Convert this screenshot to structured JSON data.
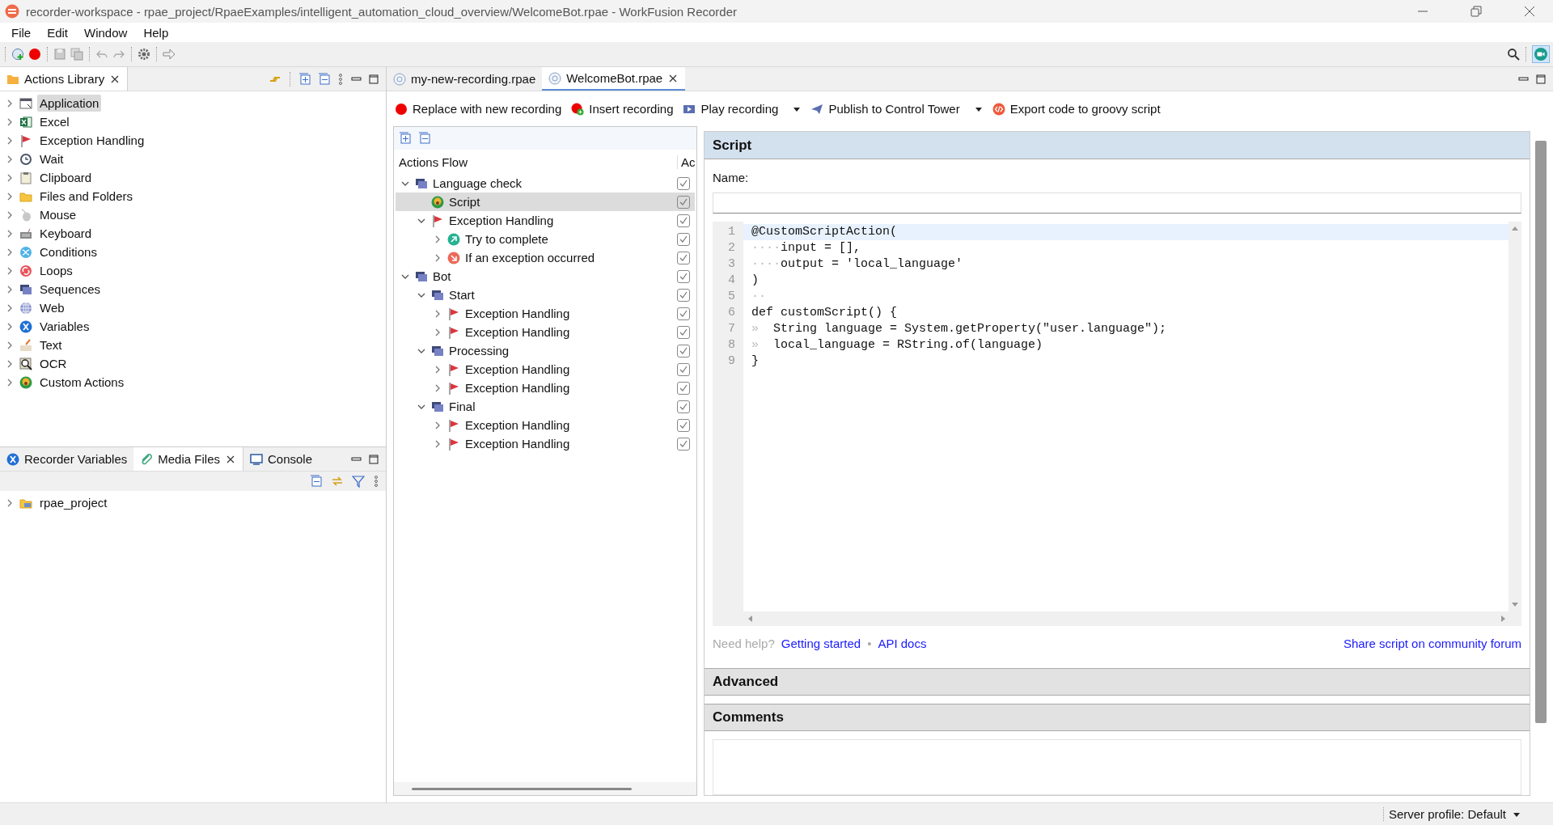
{
  "window": {
    "title": "recorder-workspace - rpae_project/RpaeExamples/intelligent_automation_cloud_overview/WelcomeBot.rpae - WorkFusion Recorder"
  },
  "menu": [
    "File",
    "Edit",
    "Window",
    "Help"
  ],
  "actions_library": {
    "title": "Actions Library",
    "items": [
      {
        "label": "Application",
        "kind": "application",
        "expanded": false,
        "selected": true
      },
      {
        "label": "Excel",
        "kind": "excel",
        "expanded": false,
        "selected": false
      },
      {
        "label": "Exception Handling",
        "kind": "flag",
        "expanded": false,
        "selected": false
      },
      {
        "label": "Wait",
        "kind": "clock",
        "expanded": false,
        "selected": false
      },
      {
        "label": "Clipboard",
        "kind": "clipboard",
        "expanded": false,
        "selected": false
      },
      {
        "label": "Files and Folders",
        "kind": "folder",
        "expanded": false,
        "selected": false
      },
      {
        "label": "Mouse",
        "kind": "mouse",
        "expanded": false,
        "selected": false
      },
      {
        "label": "Keyboard",
        "kind": "keyboard",
        "expanded": false,
        "selected": false
      },
      {
        "label": "Conditions",
        "kind": "conditions",
        "expanded": false,
        "selected": false
      },
      {
        "label": "Loops",
        "kind": "loops",
        "expanded": false,
        "selected": false
      },
      {
        "label": "Sequences",
        "kind": "sequence",
        "expanded": false,
        "selected": false
      },
      {
        "label": "Web",
        "kind": "globe",
        "expanded": false,
        "selected": false
      },
      {
        "label": "Variables",
        "kind": "variable",
        "expanded": false,
        "selected": false
      },
      {
        "label": "Text",
        "kind": "text",
        "expanded": false,
        "selected": false
      },
      {
        "label": "OCR",
        "kind": "ocr",
        "expanded": false,
        "selected": false
      },
      {
        "label": "Custom Actions",
        "kind": "custom",
        "expanded": false,
        "selected": false
      }
    ]
  },
  "bottom_panel": {
    "tabs": [
      {
        "label": "Recorder Variables",
        "kind": "variable",
        "selected": false
      },
      {
        "label": "Media Files",
        "kind": "clip",
        "selected": true
      },
      {
        "label": "Console",
        "kind": "console",
        "selected": false
      }
    ],
    "items": [
      {
        "label": "rpae_project",
        "kind": "project",
        "expanded": false
      }
    ]
  },
  "editor_tabs": [
    {
      "label": "my-new-recording.rpae",
      "selected": false
    },
    {
      "label": "WelcomeBot.rpae",
      "selected": true
    }
  ],
  "recording_actions": [
    {
      "label": "Replace with new recording",
      "kind": "record",
      "has_menu": false
    },
    {
      "label": "Insert recording",
      "kind": "insert",
      "has_menu": false
    },
    {
      "label": "Play recording",
      "kind": "play",
      "has_menu": true
    },
    {
      "label": "Publish to Control Tower",
      "kind": "publish",
      "has_menu": true
    },
    {
      "label": "Export code to groovy script",
      "kind": "export",
      "has_menu": false
    }
  ],
  "actions_flow": {
    "columns": [
      "Actions Flow",
      "Ac"
    ],
    "items": [
      {
        "label": "Language check",
        "kind": "sequence",
        "expanded": true,
        "checked": true,
        "selected": false,
        "children": [
          {
            "label": "Script",
            "kind": "custom",
            "checked": true,
            "selected": true
          },
          {
            "label": "Exception Handling",
            "kind": "flag",
            "expanded": true,
            "checked": true,
            "selected": false,
            "children": [
              {
                "label": "Try to complete",
                "kind": "try",
                "expanded": false,
                "checked": true,
                "selected": false
              },
              {
                "label": "If an exception occurred",
                "kind": "catch",
                "expanded": false,
                "checked": true,
                "selected": false
              }
            ]
          }
        ]
      },
      {
        "label": "Bot",
        "kind": "sequence",
        "expanded": true,
        "checked": true,
        "selected": false,
        "children": [
          {
            "label": "Start",
            "kind": "sequence",
            "expanded": true,
            "checked": true,
            "selected": false,
            "children": [
              {
                "label": "Exception Handling",
                "kind": "flag",
                "expanded": false,
                "checked": true,
                "selected": false
              },
              {
                "label": "Exception Handling",
                "kind": "flag",
                "expanded": false,
                "checked": true,
                "selected": false
              }
            ]
          },
          {
            "label": "Processing",
            "kind": "sequence",
            "expanded": true,
            "checked": true,
            "selected": false,
            "children": [
              {
                "label": "Exception Handling",
                "kind": "flag",
                "expanded": false,
                "checked": true,
                "selected": false
              },
              {
                "label": "Exception Handling",
                "kind": "flag",
                "expanded": false,
                "checked": true,
                "selected": false
              }
            ]
          },
          {
            "label": "Final",
            "kind": "sequence",
            "expanded": true,
            "checked": true,
            "selected": false,
            "children": [
              {
                "label": "Exception Handling",
                "kind": "flag",
                "expanded": false,
                "checked": true,
                "selected": false
              },
              {
                "label": "Exception Handling",
                "kind": "flag",
                "expanded": false,
                "checked": true,
                "selected": false
              }
            ]
          }
        ]
      }
    ]
  },
  "script": {
    "title": "Script",
    "name_label": "Name:",
    "lines": [
      {
        "number": "1",
        "text": "@CustomScriptAction(",
        "current": true
      },
      {
        "number": "2",
        "indent": "····",
        "text": "input = [],",
        "current": false
      },
      {
        "number": "3",
        "indent": "····",
        "text": "output = 'local_language'",
        "current": false
      },
      {
        "number": "4",
        "text": ")",
        "current": false
      },
      {
        "number": "5",
        "indent": "··",
        "current": false
      },
      {
        "number": "6",
        "text": "def customScript() {",
        "current": false
      },
      {
        "number": "7",
        "indent": "»  ",
        "text": "String language = System.getProperty(\"user.language\");",
        "current": false
      },
      {
        "number": "8",
        "indent": "»  ",
        "text": "local_language = RString.of(language)",
        "current": false
      },
      {
        "number": "9",
        "text": "}",
        "current": false
      }
    ],
    "help_prompt": "Need help?",
    "help_links": [
      "Getting started",
      "API docs"
    ],
    "separator": "•",
    "share_link": "Share script on community forum"
  },
  "sections": [
    {
      "title": "Advanced"
    },
    {
      "title": "Comments"
    }
  ],
  "status_bar": {
    "server_profile": "Server profile: Default"
  }
}
